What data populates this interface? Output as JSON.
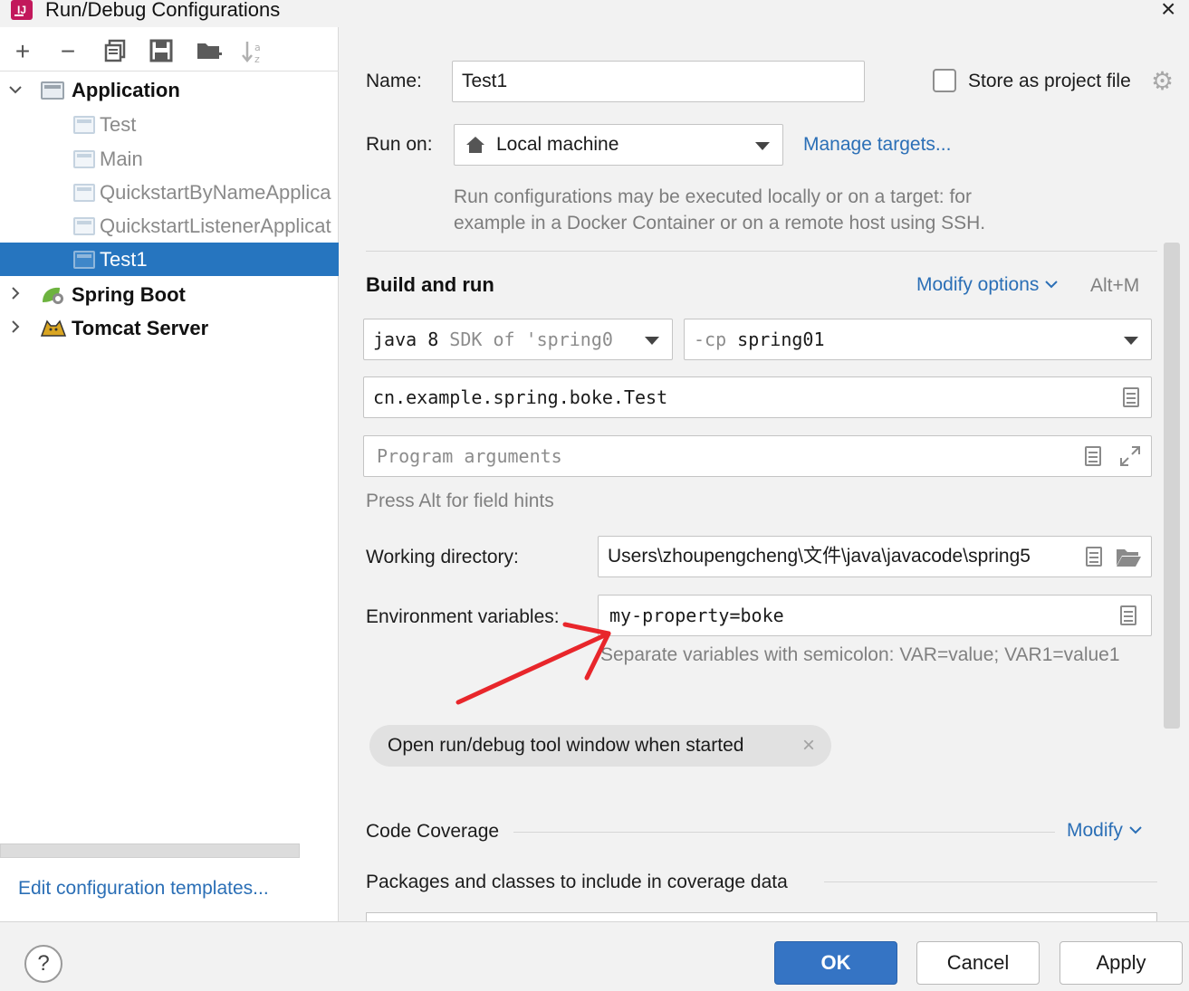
{
  "window": {
    "title": "Run/Debug Configurations",
    "app_icon_text": "IJ"
  },
  "toolbar": {
    "icons": [
      "add-icon",
      "remove-icon",
      "copy-icon",
      "save-icon",
      "folder-add-icon",
      "sort-icon"
    ],
    "add": "+",
    "remove": "−"
  },
  "tree": {
    "groups": [
      {
        "label": "Application",
        "expanded": true,
        "children": [
          "Test",
          "Main",
          "QuickstartByNameApplica",
          "QuickstartListenerApplicat",
          "Test1"
        ],
        "selected": "Test1"
      },
      {
        "label": "Spring Boot",
        "expanded": false
      },
      {
        "label": "Tomcat Server",
        "expanded": false
      }
    ]
  },
  "left_footer": {
    "edit_templates": "Edit configuration templates..."
  },
  "form": {
    "name_label": "Name:",
    "name_value": "Test1",
    "store_as_project_file": "Store as project file",
    "store_checked": false,
    "run_on_label": "Run on:",
    "run_on_value": "Local machine",
    "manage_targets": "Manage targets...",
    "run_on_hint_line1": "Run configurations may be executed locally or on a target: for",
    "run_on_hint_line2": "example in a Docker Container or on a remote host using SSH.",
    "build_and_run": "Build and run",
    "modify_options": "Modify options",
    "modify_options_shortcut": "Alt+M",
    "sdk_prefix": "java 8",
    "sdk_suffix": "SDK of 'spring0",
    "cp_prefix": "-cp",
    "cp_value": "spring01",
    "main_class": "cn.example.spring.boke.Test",
    "program_args_placeholder": "Program arguments",
    "field_hints": "Press Alt for field hints",
    "working_dir_label": "Working directory:",
    "working_dir_value": "Users\\zhoupengcheng\\文件\\java\\javacode\\spring5",
    "env_label": "Environment variables:",
    "env_value": "my-property=boke",
    "env_hint": "Separate variables with semicolon: VAR=value; VAR1=value1",
    "chip_label": "Open run/debug tool window when started",
    "code_coverage": "Code Coverage",
    "modify": "Modify",
    "packages_label": "Packages and classes to include in coverage data"
  },
  "buttons": {
    "help": "?",
    "ok": "OK",
    "cancel": "Cancel",
    "apply": "Apply"
  },
  "colors": {
    "accent": "#3574c4",
    "selection": "#2675bf",
    "link": "#2b6fb6",
    "annotation_arrow": "#e8262b"
  }
}
